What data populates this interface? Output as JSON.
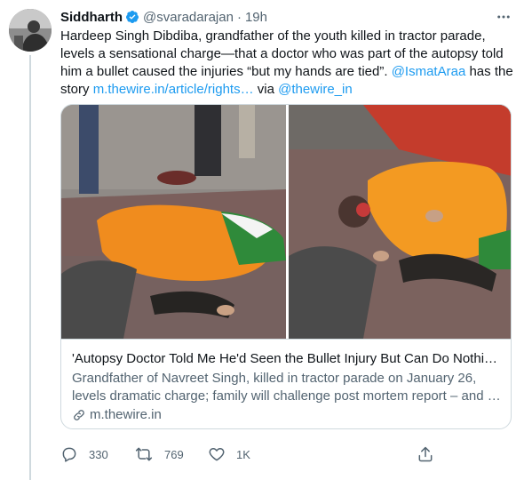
{
  "author": {
    "name": "Siddharth",
    "handle": "@svaradarajan",
    "separator": "·",
    "time": "19h"
  },
  "tweet": {
    "text_part1": "Hardeep Singh Dibdiba, grandfather of the youth killed in tractor parade, levels a sensational charge—that a doctor who was part of the autopsy told him a bullet caused the injuries “but my hands are tied”. ",
    "mention1": "@IsmatAraa",
    "text_part2": " has the story ",
    "link": "m.thewire.in/article/rights…",
    "text_part3": " via ",
    "mention2": "@thewire_in"
  },
  "card": {
    "title": "'Autopsy Doctor Told Me He'd Seen the Bullet Injury But Can Do Nothin…",
    "desc_line1": "Grandfather of Navreet Singh, killed in tractor parade on January 26,",
    "desc_line2": "levels dramatic charge; family will challenge post mortem report – and …",
    "domain": "m.thewire.in"
  },
  "actions": {
    "replies": "330",
    "retweets": "769",
    "likes": "1K"
  },
  "icons": {
    "verified": "verified-badge-icon",
    "more": "more-icon",
    "link": "link-icon",
    "reply": "reply-icon",
    "retweet": "retweet-icon",
    "like": "heart-icon",
    "share": "share-icon"
  },
  "colors": {
    "accent": "#1d9bf0",
    "text": "#0f1419",
    "muted": "#536471",
    "border": "#cfd9de"
  }
}
